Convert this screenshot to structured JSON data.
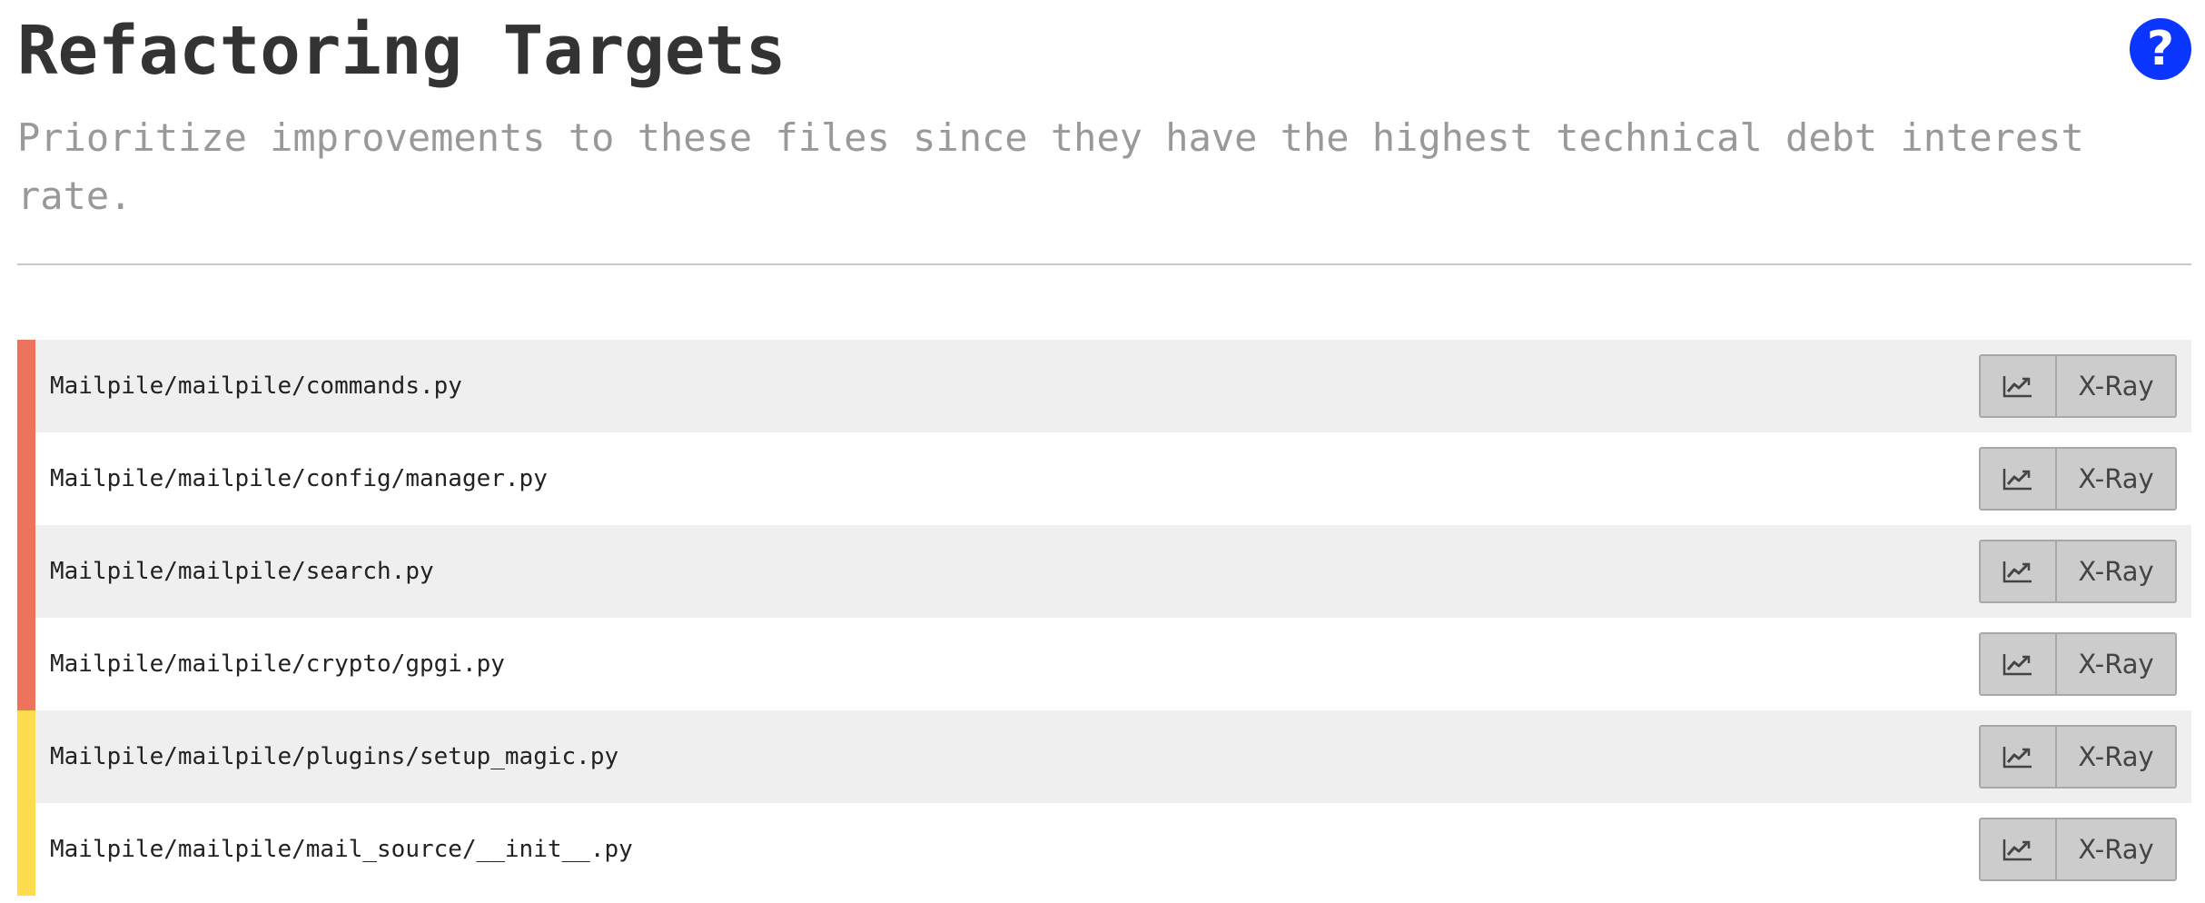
{
  "header": {
    "title": "Refactoring Targets",
    "subtitle": "Prioritize improvements to these files since they have the highest technical debt interest rate.",
    "help_label": "?",
    "help_icon": "question-circle-icon"
  },
  "colors": {
    "high_priority": "#ee735c",
    "medium_priority": "#fddc4d",
    "help_button": "#0b36ff",
    "row_alt": "#efefef",
    "button_bg": "#cccccc"
  },
  "targets": [
    {
      "path": "Mailpile/mailpile/commands.py",
      "priority": "high",
      "trend_icon": "line-chart-icon",
      "xray_label": "X-Ray"
    },
    {
      "path": "Mailpile/mailpile/config/manager.py",
      "priority": "high",
      "trend_icon": "line-chart-icon",
      "xray_label": "X-Ray"
    },
    {
      "path": "Mailpile/mailpile/search.py",
      "priority": "high",
      "trend_icon": "line-chart-icon",
      "xray_label": "X-Ray"
    },
    {
      "path": "Mailpile/mailpile/crypto/gpgi.py",
      "priority": "high",
      "trend_icon": "line-chart-icon",
      "xray_label": "X-Ray"
    },
    {
      "path": "Mailpile/mailpile/plugins/setup_magic.py",
      "priority": "medium",
      "trend_icon": "line-chart-icon",
      "xray_label": "X-Ray"
    },
    {
      "path": "Mailpile/mailpile/mail_source/__init__.py",
      "priority": "medium",
      "trend_icon": "line-chart-icon",
      "xray_label": "X-Ray"
    }
  ]
}
